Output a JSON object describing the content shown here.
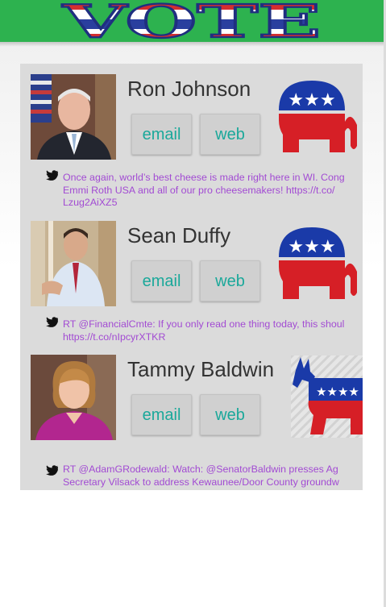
{
  "header": {
    "logo_text": "VOTE",
    "colors": {
      "bar": "#2db24f",
      "logo_red": "#d32f2f",
      "logo_blue": "#2a3f9e"
    }
  },
  "representatives": [
    {
      "name": "Ron Johnson",
      "party": "republican",
      "party_icon": "republican-elephant-icon",
      "email_label": "email",
      "web_label": "web",
      "tweet": "Once again, world’s best cheese is made right here in WI. Cong\nEmmi Roth USA and all of our pro cheesemakers! https://t.co/\nLzug2AiXZ5"
    },
    {
      "name": "Sean Duffy",
      "party": "republican",
      "party_icon": "republican-elephant-icon",
      "email_label": "email",
      "web_label": "web",
      "tweet": "RT @FinancialCmte: If you only read one thing today, this shoul\nhttps://t.co/nIpcyrXTKR"
    },
    {
      "name": "Tammy Baldwin",
      "party": "democrat",
      "party_icon": "democrat-donkey-icon",
      "email_label": "email",
      "web_label": "web",
      "tweet": "RT @AdamGRodewald: Watch: @SenatorBaldwin presses Ag\nSecretary Vilsack to address Kewaunee/Door County groundw\ncontamination issue. htt…"
    }
  ],
  "colors": {
    "tweet_text": "#a24bd3",
    "button_text": "#1aa89a",
    "list_bg": "#dbdbdb"
  }
}
